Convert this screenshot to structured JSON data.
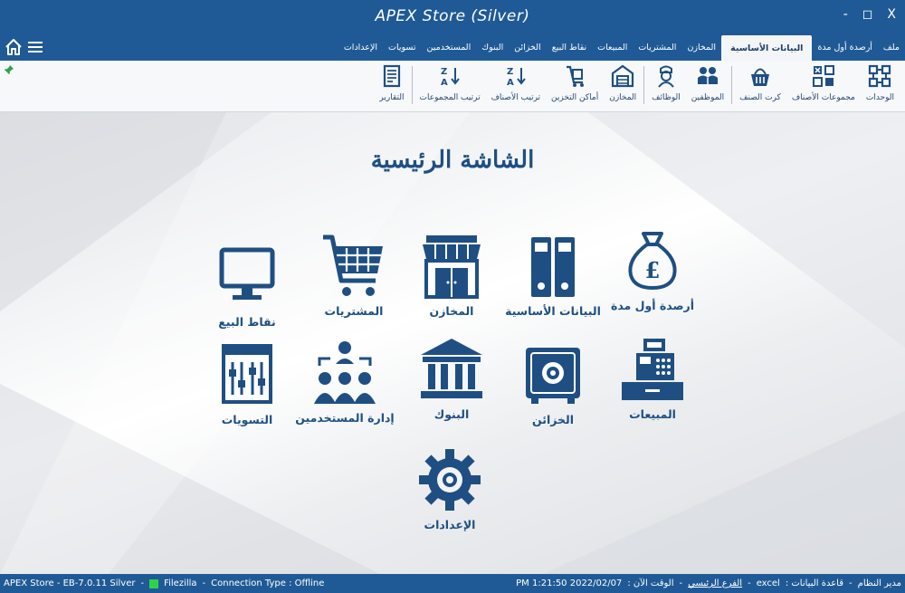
{
  "window": {
    "title": "APEX Store (Silver)",
    "minimize": "-",
    "maximize": "◻",
    "close": "X"
  },
  "menu": {
    "tabs": [
      {
        "label": "ملف"
      },
      {
        "label": "أرصدة أول مدة"
      },
      {
        "label": "البيانات الأساسية",
        "active": true
      },
      {
        "label": "المخازن"
      },
      {
        "label": "المشتريات"
      },
      {
        "label": "المبيعات"
      },
      {
        "label": "نقاط البيع"
      },
      {
        "label": "الخزائن"
      },
      {
        "label": "البنوك"
      },
      {
        "label": "المستخدمين"
      },
      {
        "label": "تسويات"
      },
      {
        "label": "الإعدادات"
      }
    ]
  },
  "ribbon": {
    "items": [
      {
        "label": "الوحدات",
        "icon": "units-icon"
      },
      {
        "label": "مجموعات الأصناف",
        "icon": "item-groups-icon"
      },
      {
        "label": "كرت الصنف",
        "icon": "item-card-icon"
      },
      {
        "label": "الموظفين",
        "icon": "employees-icon"
      },
      {
        "label": "الوظائف",
        "icon": "jobs-icon"
      },
      {
        "label": "المخازن",
        "icon": "warehouses-icon"
      },
      {
        "label": "أماكن التخزين",
        "icon": "storage-locations-icon"
      },
      {
        "label": "ترتيب الأصناف",
        "icon": "sort-items-icon"
      },
      {
        "label": "ترتيب المجموعات",
        "icon": "sort-groups-icon"
      },
      {
        "label": "التقارير",
        "icon": "reports-icon"
      }
    ]
  },
  "main": {
    "title": "الشاشة الرئيسية",
    "tiles": [
      {
        "label": "أرصدة أول مدة",
        "icon": "money-bag-icon"
      },
      {
        "label": "البيانات الأساسية",
        "icon": "binders-icon"
      },
      {
        "label": "المخازن",
        "icon": "store-icon"
      },
      {
        "label": "المشتريات",
        "icon": "cart-icon"
      },
      {
        "label": "نقاط البيع",
        "icon": "monitor-icon"
      },
      {
        "label": "المبيعات",
        "icon": "cash-register-icon"
      },
      {
        "label": "الخزائن",
        "icon": "safe-icon"
      },
      {
        "label": "البنوك",
        "icon": "bank-icon"
      },
      {
        "label": "إدارة المستخدمين",
        "icon": "users-icon"
      },
      {
        "label": "التسويات",
        "icon": "adjustments-icon"
      },
      {
        "label": "الإعدادات",
        "icon": "gear-icon"
      }
    ]
  },
  "status": {
    "app": "APEX Store - EB-7.0.11 Silver",
    "sep1": "-",
    "server": "Filezilla",
    "sep2": "-",
    "connection": "Connection Type :  Offline",
    "admin": "مدير النظام",
    "sep3": "-",
    "db_label": "قاعدة البيانات :",
    "db_value": "excel",
    "sep4": "-",
    "branch": "الفرع الرئيسي",
    "sep5": "-",
    "time_label": "الوقت الآن :",
    "time_value": "PM 1:21:50 2022/02/07"
  },
  "colors": {
    "primary": "#1f5a96",
    "icon": "#1f4f82",
    "status_ok": "#2fd14b"
  }
}
